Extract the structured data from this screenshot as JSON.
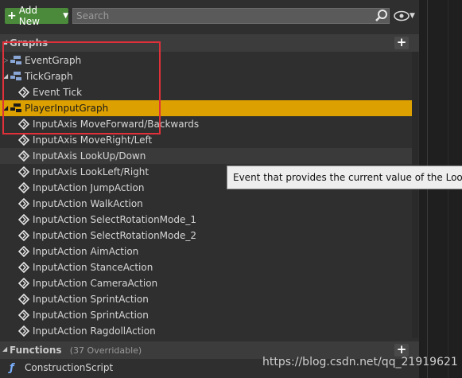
{
  "toolbar": {
    "add_new_label": "Add New",
    "search_placeholder": "Search"
  },
  "graphs_section": {
    "title": "Graphs",
    "items": [
      {
        "label": "EventGraph",
        "icon": "graph-icon",
        "expand": "collapsed"
      },
      {
        "label": "TickGraph",
        "icon": "graph-icon",
        "expand": "expanded"
      },
      {
        "label": "Event Tick",
        "icon": "event-icon"
      },
      {
        "label": "PlayerInputGraph",
        "icon": "graph-icon",
        "expand": "expanded",
        "selected": true
      },
      {
        "label": "InputAxis MoveForward/Backwards",
        "icon": "event-icon"
      },
      {
        "label": "InputAxis MoveRight/Left",
        "icon": "event-icon"
      },
      {
        "label": "InputAxis LookUp/Down",
        "icon": "event-icon",
        "hovered": true
      },
      {
        "label": "InputAxis LookLeft/Right",
        "icon": "event-icon"
      },
      {
        "label": "InputAction JumpAction",
        "icon": "event-icon"
      },
      {
        "label": "InputAction WalkAction",
        "icon": "event-icon"
      },
      {
        "label": "InputAction SelectRotationMode_1",
        "icon": "event-icon"
      },
      {
        "label": "InputAction SelectRotationMode_2",
        "icon": "event-icon"
      },
      {
        "label": "InputAction AimAction",
        "icon": "event-icon"
      },
      {
        "label": "InputAction StanceAction",
        "icon": "event-icon"
      },
      {
        "label": "InputAction CameraAction",
        "icon": "event-icon"
      },
      {
        "label": "InputAction SprintAction",
        "icon": "event-icon"
      },
      {
        "label": "InputAction SprintAction",
        "icon": "event-icon"
      },
      {
        "label": "InputAction RagdollAction",
        "icon": "event-icon"
      }
    ]
  },
  "tooltip": {
    "text": "Event that provides the current value of the LookUp/Down"
  },
  "functions_section": {
    "title": "Functions",
    "subtitle": "(37 Overridable)",
    "items": [
      {
        "label": "ConstructionScript",
        "icon": "function-icon"
      }
    ]
  },
  "watermark": "https://blog.csdn.net/qq_21919621",
  "colors": {
    "selected_row": "#dca000",
    "add_new_button": "#4a8a3a",
    "highlight_box": "#e0303a"
  }
}
